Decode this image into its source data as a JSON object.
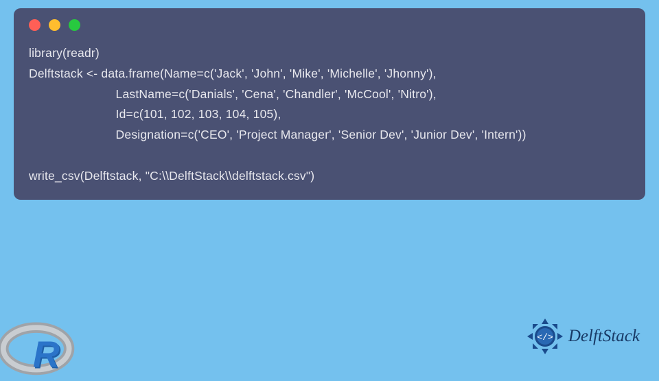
{
  "code": {
    "line1": "library(readr)",
    "line2": "Delftstack <- data.frame(Name=c('Jack', 'John', 'Mike', 'Michelle', 'Jhonny'),",
    "line3": "                         LastName=c('Danials', 'Cena', 'Chandler', 'McCool', 'Nitro'),",
    "line4": "                         Id=c(101, 102, 103, 104, 105),",
    "line5": "                         Designation=c('CEO', 'Project Manager', 'Senior Dev', 'Junior Dev', 'Intern'))",
    "line6": "",
    "line7": "write_csv(Delftstack, \"C:\\\\DelftStack\\\\delftstack.csv\")"
  },
  "logos": {
    "r_letter": "R",
    "delftstack_text": "DelftStack"
  }
}
